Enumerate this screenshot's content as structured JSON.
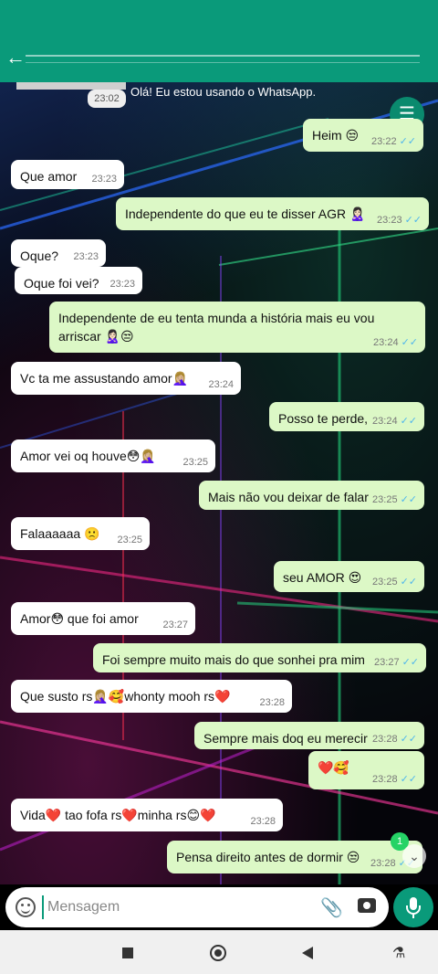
{
  "system_message": {
    "time": "23:02",
    "text": "Olá! Eu estou usando o WhatsApp."
  },
  "composer": {
    "placeholder": "Mensagem"
  },
  "unread_count": "1",
  "icons": {
    "back": "arrow-left-icon",
    "filter": "sliders-icon",
    "emoji": "smiley-icon",
    "attach": "paperclip-icon",
    "camera": "camera-icon",
    "mic": "microphone-icon",
    "scroll": "chevron-double-down-icon"
  },
  "colors": {
    "header": "#0a9a7a",
    "incoming": "#ffffff",
    "outgoing": "#dcf8c6",
    "ticks": "#4fb6ec"
  },
  "messages": [
    {
      "dir": "out",
      "text": "Heim 😒",
      "time": "23:22"
    },
    {
      "dir": "in",
      "text": "Que amor",
      "time": "23:23"
    },
    {
      "dir": "out",
      "text": "Independente do que eu te disser AGR 🙎🏻‍♀️",
      "time": "23:23"
    },
    {
      "dir": "in",
      "text": "Oque?",
      "time": "23:23"
    },
    {
      "dir": "in",
      "text": "Oque foi vei?",
      "time": "23:23"
    },
    {
      "dir": "out",
      "text": "Independente de eu tenta munda a história mais eu vou arriscar 🙎🏻‍♀️😒",
      "time": "23:24"
    },
    {
      "dir": "in",
      "text": "Vc ta me assustando amor🤦🏼‍♀️",
      "time": "23:24"
    },
    {
      "dir": "out",
      "text": "Posso te perde,",
      "time": "23:24"
    },
    {
      "dir": "in",
      "text": "Amor vei oq houve😳🤦🏼‍♀️",
      "time": "23:25"
    },
    {
      "dir": "out",
      "text": "Mais não vou deixar de falar",
      "time": "23:25"
    },
    {
      "dir": "in",
      "text": "Falaaaaaa 🙁",
      "time": "23:25"
    },
    {
      "dir": "out",
      "text": "seu AMOR 😍",
      "time": "23:25"
    },
    {
      "dir": "in",
      "text": "Amor😳 que foi amor",
      "time": "23:27"
    },
    {
      "dir": "out",
      "text": "Foi sempre muito mais do que sonhei pra mim",
      "time": "23:27"
    },
    {
      "dir": "in",
      "text": "Que susto rs🤦🏼‍♀️🥰whonty mooh rs❤️",
      "time": "23:28"
    },
    {
      "dir": "out",
      "text": "Sempre mais doq eu merecir",
      "time": "23:28"
    },
    {
      "dir": "out",
      "text": "❤️🥰",
      "time": "23:28"
    },
    {
      "dir": "in",
      "text": "Vida❤️ tao fofa rs❤️minha rs😊❤️",
      "time": "23:28"
    },
    {
      "dir": "out",
      "text": "Pensa direito antes de dormir 😒",
      "time": "23:28"
    }
  ]
}
